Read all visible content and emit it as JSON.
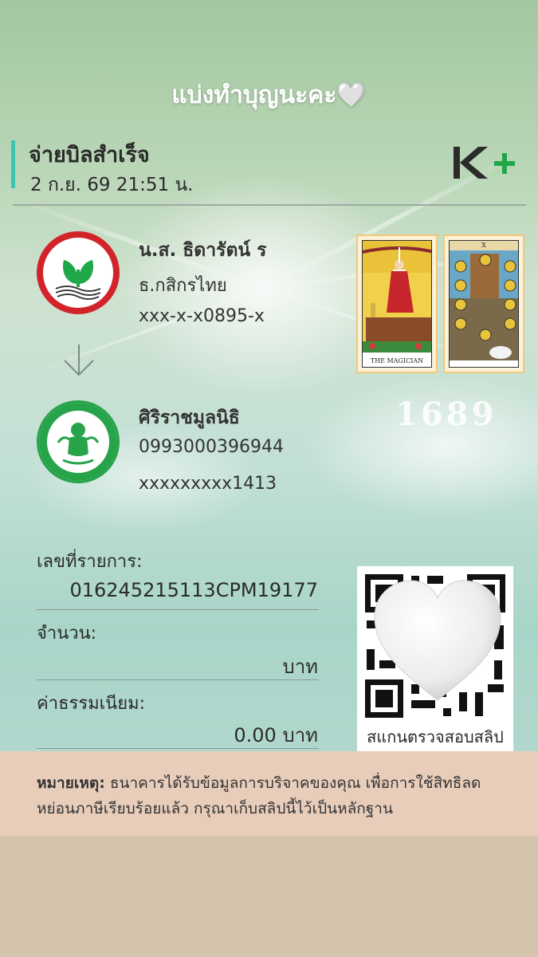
{
  "caption": "แบ่งทำบุญนะคะ🤍",
  "status": {
    "title": "จ่ายบิลสำเร็จ",
    "datetime": "2 ก.ย. 69  21:51 น."
  },
  "brand": {
    "logo_text": "K+",
    "color": "#1b7a3a",
    "accent": "#3ec4b1"
  },
  "sender": {
    "name": "น.ส. ธิดารัตน์ ร",
    "bank": "ธ.กสิกรไทย",
    "account": "xxx-x-x0895-x",
    "logo_icon": "kbank-logo"
  },
  "receiver": {
    "name": "ศิริราชมูลนิธิ",
    "biller_id": "0993000396944",
    "ref": "xxxxxxxxx1413",
    "logo_icon": "siriraj-foundation-logo"
  },
  "decor": {
    "card1_title": "THE MAGICIAN",
    "card2_numeral": "X",
    "number": "1689"
  },
  "details": {
    "ref_label": "เลขที่รายการ:",
    "ref_value": "016245215113CPM19177",
    "amount_label": "จำนวน:",
    "amount_value": "บาท",
    "fee_label": "ค่าธรรมเนียม:",
    "fee_value": "0.00 บาท"
  },
  "qr": {
    "caption": "สแกนตรวจสอบสลิป",
    "overlay_icon": "heart-icon"
  },
  "note": {
    "label": "หมายเหตุ:",
    "text": "ธนาคารได้รับข้อมูลการบริจาคของคุณ เพื่อการใช้สิทธิลดหย่อนภาษีเรียบร้อยแล้ว กรุณาเก็บสลิปนี้ไว้เป็นหลักฐาน"
  }
}
